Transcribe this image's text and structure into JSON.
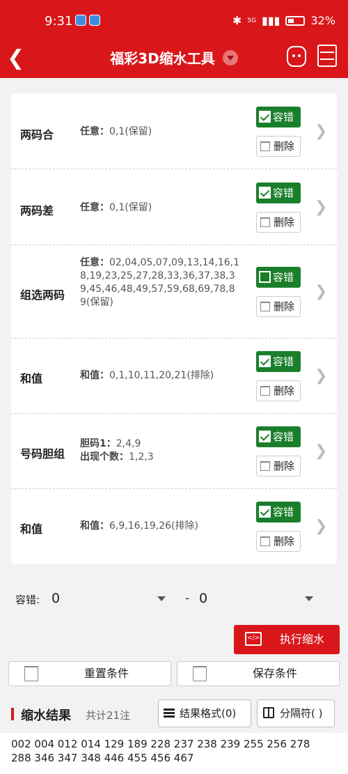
{
  "status": {
    "time": "9:31",
    "network": "5G",
    "battery": "32%"
  },
  "header": {
    "title": "福彩3D缩水工具"
  },
  "conditions": [
    {
      "name": "两码合",
      "lines": [
        {
          "label": "任意：",
          "value": "0,1(保留)"
        }
      ],
      "tolerance_label": "容错",
      "tolerance_checked": true,
      "delete_label": "删除"
    },
    {
      "name": "两码差",
      "lines": [
        {
          "label": "任意：",
          "value": "0,1(保留)"
        }
      ],
      "tolerance_label": "容错",
      "tolerance_checked": true,
      "delete_label": "删除"
    },
    {
      "name": "组选两码",
      "lines": [
        {
          "label": "任意：",
          "value": "02,04,05,07,09,13,14,16,18,19,23,25,27,28,33,36,37,38,39,45,46,48,49,57,59,68,69,78,89(保留)"
        }
      ],
      "tolerance_label": "容错",
      "tolerance_checked": false,
      "delete_label": "删除"
    },
    {
      "name": "和值",
      "lines": [
        {
          "label": "和值：",
          "value": "0,1,10,11,20,21(排除)"
        }
      ],
      "tolerance_label": "容错",
      "tolerance_checked": true,
      "delete_label": "删除"
    },
    {
      "name": "号码胆组",
      "lines": [
        {
          "label": "胆码1：",
          "value": "2,4,9"
        },
        {
          "label": "出现个数：",
          "value": "1,2,3"
        }
      ],
      "tolerance_label": "容错",
      "tolerance_checked": true,
      "delete_label": "删除"
    },
    {
      "name": "和值",
      "lines": [
        {
          "label": "和值：",
          "value": "6,9,16,19,26(排除)"
        }
      ],
      "tolerance_label": "容错",
      "tolerance_checked": true,
      "delete_label": "删除"
    }
  ],
  "tolerance": {
    "label": "容错:",
    "min": "0",
    "separator": "-",
    "max": "0"
  },
  "actions": {
    "execute": "执行缩水",
    "reset": "重置条件",
    "save": "保存条件"
  },
  "result": {
    "title": "缩水结果",
    "count": "共计21注",
    "format_label": "结果格式(0)",
    "separator_label": "分隔符( )",
    "line1": "002 004 012 014 129 189 228 237 238 239 255 256 278",
    "line2": "288 346 347 348 446 455 456 467"
  }
}
